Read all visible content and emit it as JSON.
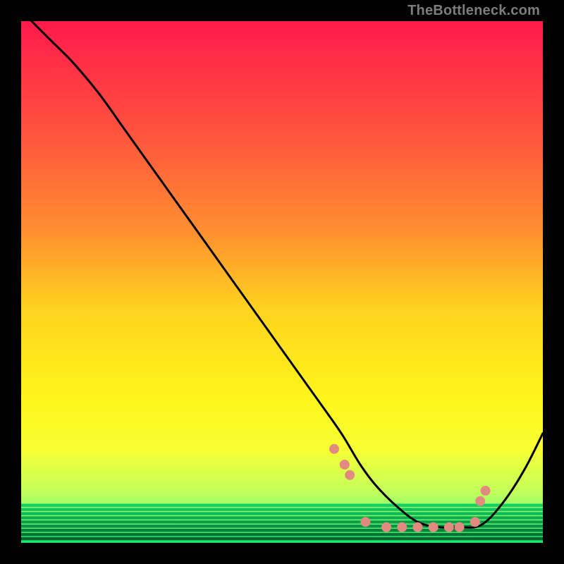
{
  "watermark": "TheBottleneck.com",
  "chart_data": {
    "type": "line",
    "title": "",
    "xlabel": "",
    "ylabel": "",
    "xlim": [
      0,
      100
    ],
    "ylim": [
      0,
      100
    ],
    "grid": false,
    "legend": false,
    "gradient_stops": [
      {
        "offset": 0.0,
        "color": "#ff1a4b"
      },
      {
        "offset": 0.2,
        "color": "#ff4f3f"
      },
      {
        "offset": 0.4,
        "color": "#ff8e30"
      },
      {
        "offset": 0.55,
        "color": "#ffd21f"
      },
      {
        "offset": 0.72,
        "color": "#fff51a"
      },
      {
        "offset": 0.82,
        "color": "#f7ff33"
      },
      {
        "offset": 0.9,
        "color": "#c4ff5a"
      },
      {
        "offset": 0.95,
        "color": "#7fff70"
      },
      {
        "offset": 1.0,
        "color": "#17e36d"
      }
    ],
    "series": [
      {
        "name": "bottleneck-curve",
        "color": "#000000",
        "x": [
          2,
          6,
          10,
          15,
          20,
          25,
          30,
          35,
          40,
          45,
          50,
          55,
          60,
          62,
          65,
          68,
          72,
          76,
          80,
          84,
          87,
          89,
          91,
          94,
          97,
          100
        ],
        "y": [
          100,
          96,
          92,
          86,
          79,
          72,
          65,
          58,
          51,
          44,
          37,
          30,
          23,
          20,
          15,
          11,
          7,
          4,
          3,
          3,
          3,
          4,
          6,
          10,
          15,
          21
        ]
      }
    ],
    "markers": {
      "name": "highlight-dots",
      "color": "#e08a80",
      "radius": 7,
      "points": [
        {
          "x": 60,
          "y": 18
        },
        {
          "x": 62,
          "y": 15
        },
        {
          "x": 63,
          "y": 13
        },
        {
          "x": 66,
          "y": 4
        },
        {
          "x": 70,
          "y": 3
        },
        {
          "x": 73,
          "y": 3
        },
        {
          "x": 76,
          "y": 3
        },
        {
          "x": 79,
          "y": 3
        },
        {
          "x": 82,
          "y": 3
        },
        {
          "x": 84,
          "y": 3
        },
        {
          "x": 87,
          "y": 4
        },
        {
          "x": 88,
          "y": 8
        },
        {
          "x": 89,
          "y": 10
        }
      ]
    },
    "bottom_bands": [
      {
        "y": 6.9,
        "h": 0.6,
        "color": "#13cf63"
      },
      {
        "y": 6.1,
        "h": 0.6,
        "color": "#12c45d"
      },
      {
        "y": 5.3,
        "h": 0.6,
        "color": "#10b956"
      },
      {
        "y": 4.5,
        "h": 0.6,
        "color": "#0eab50"
      },
      {
        "y": 3.7,
        "h": 0.6,
        "color": "#0d9d49"
      },
      {
        "y": 2.9,
        "h": 0.6,
        "color": "#0b8f42"
      },
      {
        "y": 2.1,
        "h": 0.6,
        "color": "#09803b"
      },
      {
        "y": 1.3,
        "h": 0.6,
        "color": "#077233"
      },
      {
        "y": 0.5,
        "h": 0.6,
        "color": "#06642c"
      }
    ]
  }
}
